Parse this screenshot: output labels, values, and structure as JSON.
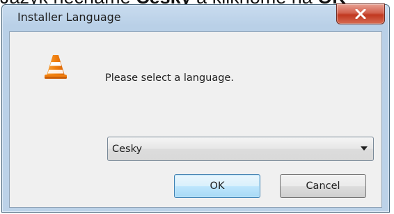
{
  "background": {
    "text_pre": "Jazyk nechame ",
    "text_bold": "Cesky",
    "text_mid": " a kliknome na ",
    "text_bold2": "OK"
  },
  "window": {
    "title": "Installer Language",
    "close_icon": "close-x-icon"
  },
  "dialog": {
    "icon": "vlc-cone-icon",
    "prompt": "Please select a language.",
    "language_select": {
      "selected": "Cesky",
      "arrow_icon": "chevron-down-icon"
    },
    "ok_label": "OK",
    "cancel_label": "Cancel"
  },
  "colors": {
    "accent": "#3c7fb1",
    "close_red": "#c1371f",
    "cone_orange": "#f07f0f"
  }
}
